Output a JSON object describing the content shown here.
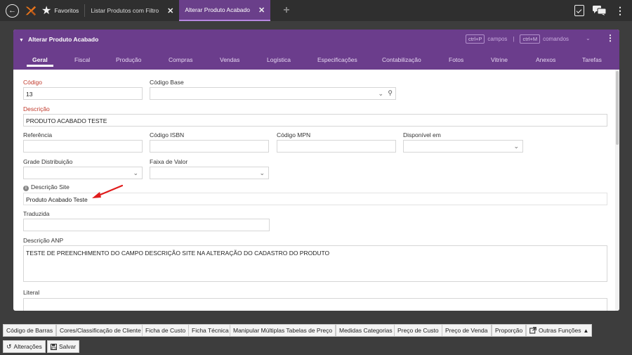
{
  "topbar": {
    "favorites_label": "Favoritos",
    "tabs": [
      {
        "label": "Listar Produtos com Filtro"
      },
      {
        "label": "Alterar Produto Acabado"
      }
    ]
  },
  "panel": {
    "title": "Alterar Produto Acabado",
    "shortcut_campos_key": "ctrl+P",
    "shortcut_campos_label": "campos",
    "shortcut_separator": "|",
    "shortcut_comandos_key": "ctrl+M",
    "shortcut_comandos_label": "comandos",
    "tabs": [
      "Geral",
      "Fiscal",
      "Produção",
      "Compras",
      "Vendas",
      "Logística",
      "Especificações",
      "Contabilização",
      "Fotos",
      "Vitrine",
      "Anexos",
      "Tarefas"
    ]
  },
  "form": {
    "codigo": {
      "label": "Código",
      "value": "13"
    },
    "codigo_base": {
      "label": "Código Base",
      "value": ""
    },
    "descricao": {
      "label": "Descrição",
      "value": "PRODUTO ACABADO TESTE"
    },
    "referencia": {
      "label": "Referência",
      "value": ""
    },
    "codigo_isbn": {
      "label": "Código ISBN",
      "value": ""
    },
    "codigo_mpn": {
      "label": "Código MPN",
      "value": ""
    },
    "disponivel_em": {
      "label": "Disponível em",
      "value": ""
    },
    "grade_distribuicao": {
      "label": "Grade Distribuição",
      "value": ""
    },
    "faixa_valor": {
      "label": "Faixa de Valor",
      "value": ""
    },
    "descricao_site": {
      "label": "Descrição Site",
      "value": "Produto Acabado Teste"
    },
    "traduzida": {
      "label": "Traduzida",
      "value": ""
    },
    "descricao_anp": {
      "label": "Descrição ANP",
      "value": "TESTE DE PREENCHIMENTO DO CAMPO DESCRIÇÃO SITE NA ALTERAÇÃO DO CADASTRO DO PRODUTO"
    },
    "literal": {
      "label": "Literal",
      "value": ""
    }
  },
  "toolbar": {
    "buttons_row1": [
      "Código de Barras",
      "Cores/Classificação de Cliente",
      "Ficha de Custo",
      "Ficha Técnica",
      "Manipular Múltiplas Tabelas de Preço",
      "Medidas Categorias",
      "Preço de Custo",
      "Preço de Venda",
      "Proporção"
    ],
    "outras_funcoes": "Outras Funções",
    "alteracoes": "Alterações",
    "salvar": "Salvar"
  },
  "colors": {
    "accent": "#6b3d8c",
    "required_label": "#c0392b",
    "annotation_arrow": "#e01b1b"
  }
}
